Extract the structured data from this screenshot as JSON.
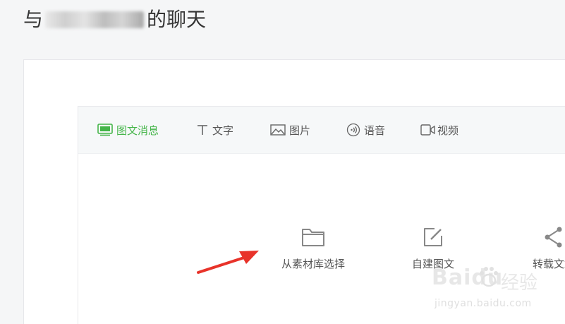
{
  "header": {
    "title_prefix": "与",
    "title_suffix": "的聊天"
  },
  "tabs": [
    {
      "label": "图文消息",
      "icon": "news-icon",
      "active": true
    },
    {
      "label": "文字",
      "icon": "text-icon",
      "active": false
    },
    {
      "label": "图片",
      "icon": "image-icon",
      "active": false
    },
    {
      "label": "语音",
      "icon": "voice-icon",
      "active": false
    },
    {
      "label": "视频",
      "icon": "video-icon",
      "active": false
    }
  ],
  "actions": [
    {
      "label": "从素材库选择",
      "icon": "folder-icon"
    },
    {
      "label": "自建图文",
      "icon": "edit-icon"
    },
    {
      "label": "转载文章",
      "icon": "share-icon"
    }
  ],
  "watermark": {
    "logo": "Baidu",
    "cn": "经验",
    "url": "jingyan.baidu.com"
  },
  "colors": {
    "accent": "#44b549",
    "arrow": "#e8332a",
    "text": "#555555"
  }
}
